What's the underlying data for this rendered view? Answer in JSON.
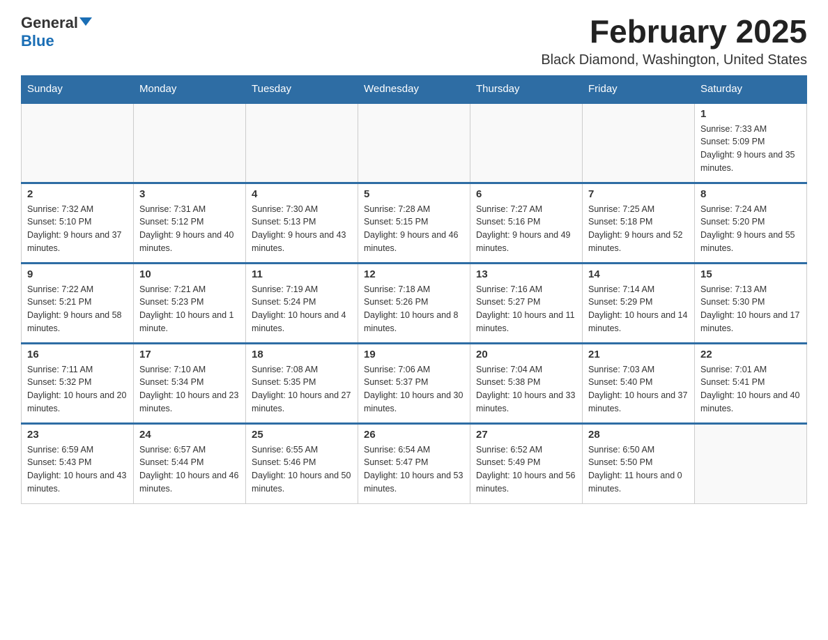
{
  "logo": {
    "general": "General",
    "blue": "Blue"
  },
  "header": {
    "month_title": "February 2025",
    "location": "Black Diamond, Washington, United States"
  },
  "weekdays": [
    "Sunday",
    "Monday",
    "Tuesday",
    "Wednesday",
    "Thursday",
    "Friday",
    "Saturday"
  ],
  "weeks": [
    {
      "days": [
        {
          "date": "",
          "info": ""
        },
        {
          "date": "",
          "info": ""
        },
        {
          "date": "",
          "info": ""
        },
        {
          "date": "",
          "info": ""
        },
        {
          "date": "",
          "info": ""
        },
        {
          "date": "",
          "info": ""
        },
        {
          "date": "1",
          "info": "Sunrise: 7:33 AM\nSunset: 5:09 PM\nDaylight: 9 hours and 35 minutes."
        }
      ]
    },
    {
      "days": [
        {
          "date": "2",
          "info": "Sunrise: 7:32 AM\nSunset: 5:10 PM\nDaylight: 9 hours and 37 minutes."
        },
        {
          "date": "3",
          "info": "Sunrise: 7:31 AM\nSunset: 5:12 PM\nDaylight: 9 hours and 40 minutes."
        },
        {
          "date": "4",
          "info": "Sunrise: 7:30 AM\nSunset: 5:13 PM\nDaylight: 9 hours and 43 minutes."
        },
        {
          "date": "5",
          "info": "Sunrise: 7:28 AM\nSunset: 5:15 PM\nDaylight: 9 hours and 46 minutes."
        },
        {
          "date": "6",
          "info": "Sunrise: 7:27 AM\nSunset: 5:16 PM\nDaylight: 9 hours and 49 minutes."
        },
        {
          "date": "7",
          "info": "Sunrise: 7:25 AM\nSunset: 5:18 PM\nDaylight: 9 hours and 52 minutes."
        },
        {
          "date": "8",
          "info": "Sunrise: 7:24 AM\nSunset: 5:20 PM\nDaylight: 9 hours and 55 minutes."
        }
      ]
    },
    {
      "days": [
        {
          "date": "9",
          "info": "Sunrise: 7:22 AM\nSunset: 5:21 PM\nDaylight: 9 hours and 58 minutes."
        },
        {
          "date": "10",
          "info": "Sunrise: 7:21 AM\nSunset: 5:23 PM\nDaylight: 10 hours and 1 minute."
        },
        {
          "date": "11",
          "info": "Sunrise: 7:19 AM\nSunset: 5:24 PM\nDaylight: 10 hours and 4 minutes."
        },
        {
          "date": "12",
          "info": "Sunrise: 7:18 AM\nSunset: 5:26 PM\nDaylight: 10 hours and 8 minutes."
        },
        {
          "date": "13",
          "info": "Sunrise: 7:16 AM\nSunset: 5:27 PM\nDaylight: 10 hours and 11 minutes."
        },
        {
          "date": "14",
          "info": "Sunrise: 7:14 AM\nSunset: 5:29 PM\nDaylight: 10 hours and 14 minutes."
        },
        {
          "date": "15",
          "info": "Sunrise: 7:13 AM\nSunset: 5:30 PM\nDaylight: 10 hours and 17 minutes."
        }
      ]
    },
    {
      "days": [
        {
          "date": "16",
          "info": "Sunrise: 7:11 AM\nSunset: 5:32 PM\nDaylight: 10 hours and 20 minutes."
        },
        {
          "date": "17",
          "info": "Sunrise: 7:10 AM\nSunset: 5:34 PM\nDaylight: 10 hours and 23 minutes."
        },
        {
          "date": "18",
          "info": "Sunrise: 7:08 AM\nSunset: 5:35 PM\nDaylight: 10 hours and 27 minutes."
        },
        {
          "date": "19",
          "info": "Sunrise: 7:06 AM\nSunset: 5:37 PM\nDaylight: 10 hours and 30 minutes."
        },
        {
          "date": "20",
          "info": "Sunrise: 7:04 AM\nSunset: 5:38 PM\nDaylight: 10 hours and 33 minutes."
        },
        {
          "date": "21",
          "info": "Sunrise: 7:03 AM\nSunset: 5:40 PM\nDaylight: 10 hours and 37 minutes."
        },
        {
          "date": "22",
          "info": "Sunrise: 7:01 AM\nSunset: 5:41 PM\nDaylight: 10 hours and 40 minutes."
        }
      ]
    },
    {
      "days": [
        {
          "date": "23",
          "info": "Sunrise: 6:59 AM\nSunset: 5:43 PM\nDaylight: 10 hours and 43 minutes."
        },
        {
          "date": "24",
          "info": "Sunrise: 6:57 AM\nSunset: 5:44 PM\nDaylight: 10 hours and 46 minutes."
        },
        {
          "date": "25",
          "info": "Sunrise: 6:55 AM\nSunset: 5:46 PM\nDaylight: 10 hours and 50 minutes."
        },
        {
          "date": "26",
          "info": "Sunrise: 6:54 AM\nSunset: 5:47 PM\nDaylight: 10 hours and 53 minutes."
        },
        {
          "date": "27",
          "info": "Sunrise: 6:52 AM\nSunset: 5:49 PM\nDaylight: 10 hours and 56 minutes."
        },
        {
          "date": "28",
          "info": "Sunrise: 6:50 AM\nSunset: 5:50 PM\nDaylight: 11 hours and 0 minutes."
        },
        {
          "date": "",
          "info": ""
        }
      ]
    }
  ]
}
